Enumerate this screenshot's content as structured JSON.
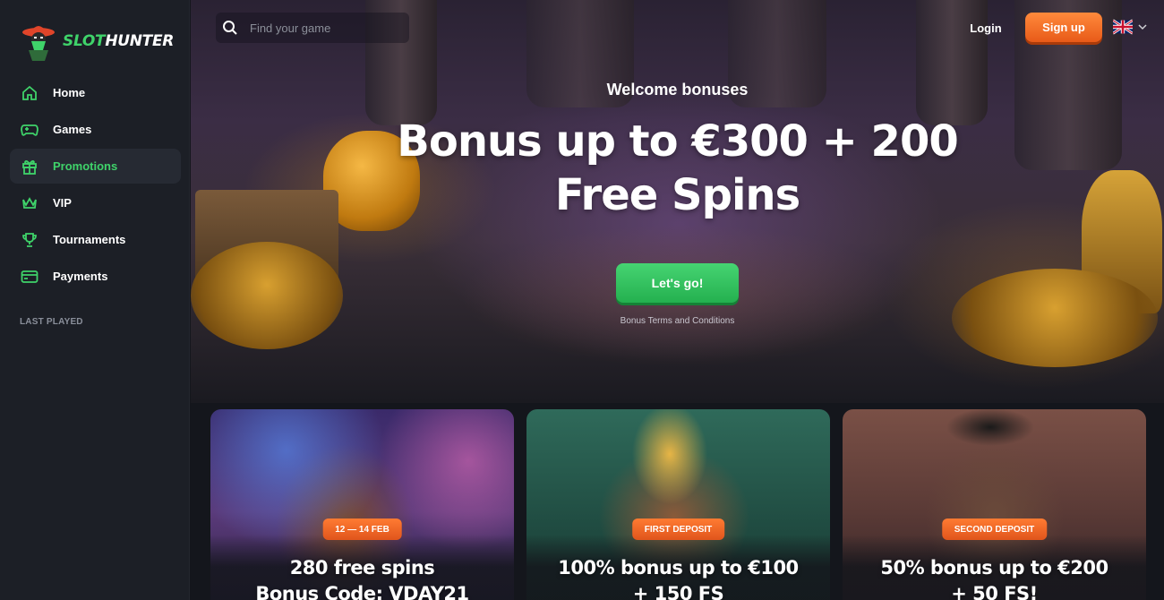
{
  "brand": {
    "logo_word1": "SLOT",
    "logo_word2": "HUNTER"
  },
  "sidebar": {
    "items": [
      {
        "label": "Home",
        "icon": "home-icon",
        "active": false
      },
      {
        "label": "Games",
        "icon": "gamepad-icon",
        "active": false
      },
      {
        "label": "Promotions",
        "icon": "gift-icon",
        "active": true
      },
      {
        "label": "VIP",
        "icon": "crown-icon",
        "active": false
      },
      {
        "label": "Tournaments",
        "icon": "trophy-icon",
        "active": false
      },
      {
        "label": "Payments",
        "icon": "card-icon",
        "active": false
      }
    ],
    "section_label": "LAST PLAYED"
  },
  "header": {
    "search_placeholder": "Find your game",
    "login_label": "Login",
    "signup_label": "Sign up",
    "language_flag": "uk-flag-icon"
  },
  "hero": {
    "subtitle": "Welcome bonuses",
    "title_line1": "Bonus up to €300 + 200",
    "title_line2": "Free Spins",
    "cta_label": "Let's go!",
    "terms_label": "Bonus Terms and Conditions"
  },
  "cards": [
    {
      "badge": "12 — 14 FEB",
      "line1": "280 free spins",
      "line2": "Bonus Code: VDAY21"
    },
    {
      "badge": "FIRST DEPOSIT",
      "line1": "100% bonus up to €100",
      "line2": "+ 150 FS"
    },
    {
      "badge": "SECOND DEPOSIT",
      "line1": "50% bonus up to €200",
      "line2": "+ 50 FS!"
    }
  ],
  "colors": {
    "accent_green": "#3fd36a",
    "signup_orange": "#f26d26",
    "sidebar_bg": "#1c1f26"
  }
}
